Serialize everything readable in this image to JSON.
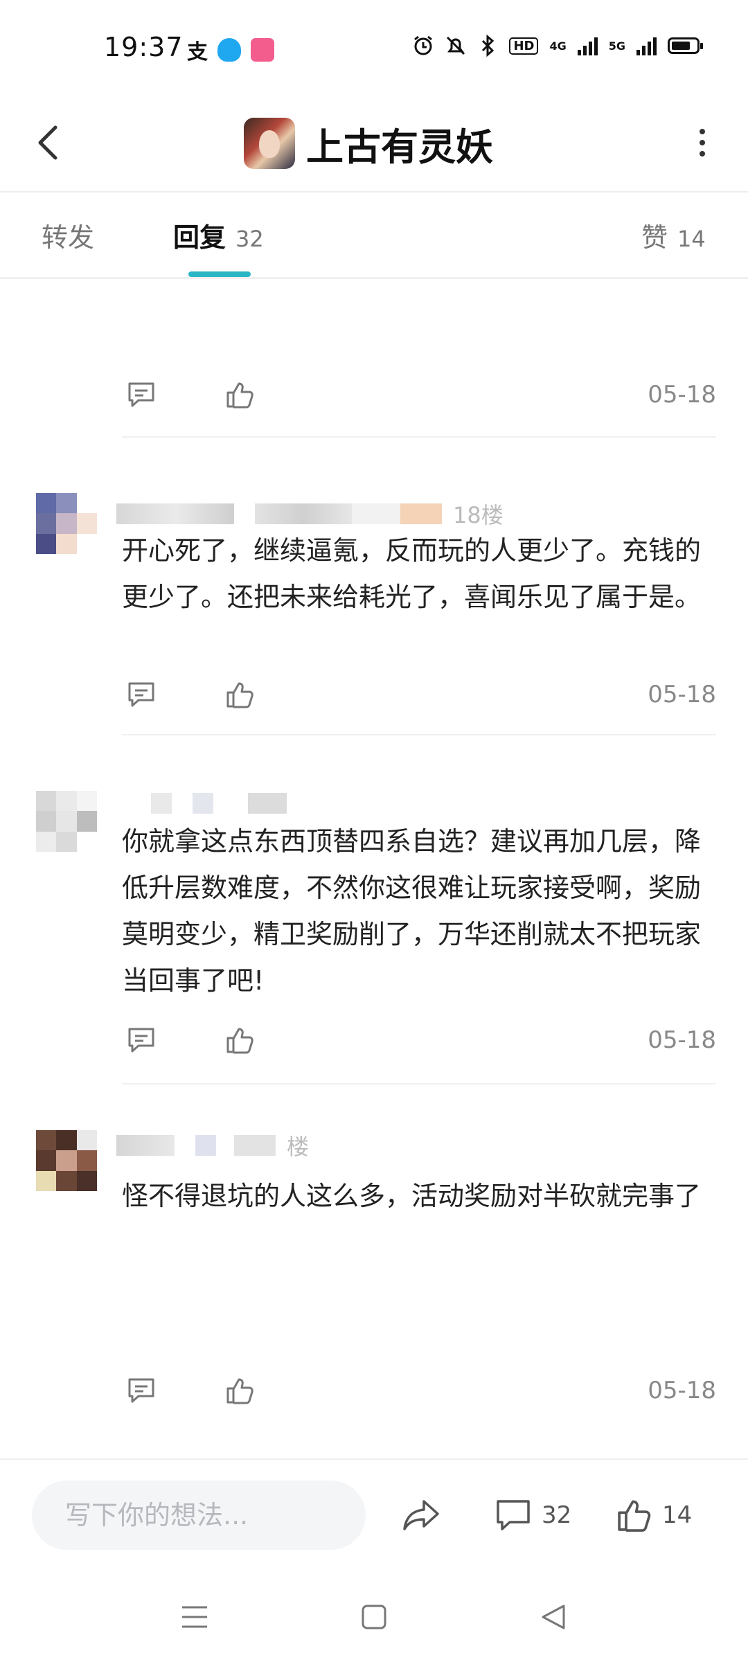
{
  "status_bar": {
    "time": "19:37",
    "hd_badge": "HD",
    "net_4g": "4G",
    "net_5g": "5G"
  },
  "header": {
    "title": "上古有灵妖"
  },
  "tabs": [
    {
      "label": "转发",
      "count": ""
    },
    {
      "label": "回复",
      "count": "32"
    },
    {
      "label": "赞",
      "count": "14"
    }
  ],
  "comments": [
    {
      "floor": "",
      "text": "",
      "date": "05-18"
    },
    {
      "floor": "18楼",
      "text": "开心死了，继续逼氪，反而玩的人更少了。充钱的更少了。还把未来给耗光了，喜闻乐见了属于是。",
      "date": "05-18"
    },
    {
      "floor": "",
      "text": "你就拿这点东西顶替四系自选？建议再加几层，降低升层数难度，不然你这很难让玩家接受啊，奖励莫明变少，精卫奖励削了，万华还削就太不把玩家当回事了吧!",
      "date": "05-18"
    },
    {
      "floor": "楼",
      "text": "怪不得退坑的人这么多，活动奖励对半砍就完事了",
      "date": "05-18"
    }
  ],
  "bottom_bar": {
    "input_placeholder": "写下你的想法...",
    "comment_count": "32",
    "like_count": "14"
  },
  "icons": {
    "back": "chevron-left-icon",
    "more": "more-vertical-icon",
    "reply": "comment-icon",
    "like": "thumbs-up-icon",
    "share": "share-icon",
    "nav_menu": "menu-icon",
    "nav_home": "square-home-icon",
    "nav_back": "triangle-back-icon"
  },
  "colors": {
    "accent": "#2bb6c5",
    "qq_blue": "#1fa8f0",
    "bili_pink": "#f25d8e"
  }
}
